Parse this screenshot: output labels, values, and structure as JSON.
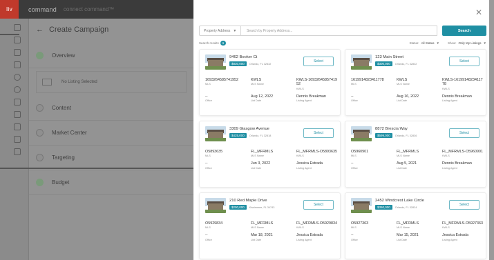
{
  "app": {
    "logo": "liv",
    "brand": "command",
    "brand_sub": "connect  command™"
  },
  "page": {
    "title": "Create Campaign",
    "steps": [
      {
        "label": "Overview"
      },
      {
        "label": "Content"
      },
      {
        "label": "Market Center"
      },
      {
        "label": "Targeting"
      },
      {
        "label": "Budget"
      }
    ],
    "no_listing": "No Listing Selected"
  },
  "modal": {
    "close_icon": "close-icon",
    "search": {
      "type_label": "Property Address",
      "placeholder": "Search by Property Address...",
      "button": "Search"
    },
    "results": {
      "label": "Search results",
      "count": "6",
      "status_label": "Status:",
      "status_value": "All Status",
      "show_label": "Show:",
      "show_value": "Only My Listings"
    },
    "select_label": "Select",
    "field_labels": {
      "mls_id": "MLS",
      "mls_name": "MLS Name",
      "kwls": "KWLS",
      "office": "Office",
      "list_date": "List Date",
      "agent": "Listing Agent"
    },
    "listings": [
      {
        "address": "9462 Booker Ct",
        "price": "$830,000",
        "city": "Orlando, FL 32832",
        "mls": "1693264585741952",
        "mls_name": "KWLS",
        "kwls": "KWLS-1693264585741952",
        "office": "--",
        "date": "Aug 12, 2022",
        "agent": "Dennis Breakman"
      },
      {
        "address": "123 Main Street",
        "price": "$300,000",
        "city": "Orlando, FL 32832",
        "mls": "1619914823411778",
        "mls_name": "KWLS",
        "kwls": "KWLS-1619914823411778",
        "office": "--",
        "date": "Aug 16, 2022",
        "agent": "Dennis Breakman"
      },
      {
        "address": "3309 Glasgow Avenue",
        "price": "$425,000",
        "city": "Orlando, FL 32818",
        "mls": "O5893635",
        "mls_name": "FL_MFRMLS",
        "kwls": "FL_MFRMLS-O5893635",
        "office": "--",
        "date": "Jun 3, 2022",
        "agent": "Jessica Estrada"
      },
      {
        "address": "8872 Brescia Way",
        "price": "$599,000",
        "city": "Orlando, FL 32836",
        "mls": "O5960901",
        "mls_name": "FL_MFRMLS",
        "kwls": "FL_MFRMLS-O5960901",
        "office": "--",
        "date": "Aug 5, 2021",
        "agent": "Dennis Breakman"
      },
      {
        "address": "210 Red Maple Drive",
        "price": "$200,000",
        "city": "Kissimmee, FL 34743",
        "mls": "O5929834",
        "mls_name": "FL_MFRMLS",
        "kwls": "FL_MFRMLS-O5929834",
        "office": "--",
        "date": "Mar 18, 2021",
        "agent": "Jessica Estrada"
      },
      {
        "address": "2452 Windcrest Lake Circle",
        "price": "$350,000",
        "city": "Orlando, FL 32824",
        "mls": "O5927363",
        "mls_name": "FL_MFRMLS",
        "kwls": "FL_MFRMLS-O5927363",
        "office": "--",
        "date": "Mar 15, 2021",
        "agent": "Jessica Estrada"
      }
    ]
  },
  "colors": {
    "accent": "#1f8fa3",
    "logo_bg": "#c0392b"
  }
}
